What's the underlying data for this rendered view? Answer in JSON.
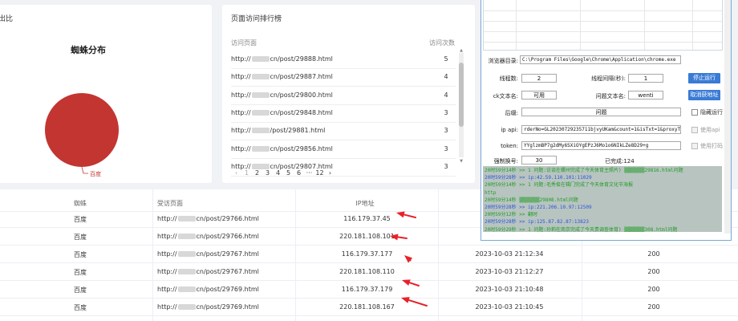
{
  "spider_card": {
    "title_fragment": "出比",
    "chart_title": "蜘蛛分布",
    "legend_label": "百度",
    "chart_data": {
      "type": "pie",
      "categories": [
        "百度"
      ],
      "values": [
        100
      ],
      "title": "蜘蛛分布",
      "colors": [
        "#c23531"
      ]
    }
  },
  "rank_card": {
    "title": "页面访问排行榜",
    "col_page": "访问页面",
    "col_count": "访问次数",
    "rows": [
      {
        "prefix": "http://",
        "suffix": "cn/post/29888.html",
        "count": "5"
      },
      {
        "prefix": "http://",
        "suffix": "cn/post/29887.html",
        "count": "4"
      },
      {
        "prefix": "http://",
        "suffix": "cn/post/29800.html",
        "count": "4"
      },
      {
        "prefix": "http://",
        "suffix": "cn/post/29848.html",
        "count": "3"
      },
      {
        "prefix": "http://",
        "suffix": "/post/29881.html",
        "count": "3"
      },
      {
        "prefix": "http://",
        "suffix": "cn/post/29856.html",
        "count": "3"
      },
      {
        "prefix": "http://",
        "suffix": "cn/post/29807.html",
        "count": "3"
      }
    ],
    "pager": {
      "prev": "‹",
      "pages": [
        "1",
        "2",
        "3",
        "4",
        "5",
        "6",
        "···",
        "12"
      ],
      "next": "›"
    }
  },
  "table": {
    "headers": {
      "spider": "蜘蛛",
      "page": "受访页面",
      "ip": "IP地址"
    },
    "rows": [
      {
        "spider": "百度",
        "prefix": "http://",
        "suffix": "cn/post/29766.html",
        "ip": "116.179.37.45",
        "time": "",
        "status": ""
      },
      {
        "spider": "百度",
        "prefix": "http://",
        "suffix": "cn/post/29766.html",
        "ip": "220.181.108.101",
        "time": "",
        "status": ""
      },
      {
        "spider": "百度",
        "prefix": "http://",
        "suffix": "cn/post/29767.html",
        "ip": "116.179.37.177",
        "time": "2023-10-03 21:12:34",
        "status": "200"
      },
      {
        "spider": "百度",
        "prefix": "http://",
        "suffix": "cn/post/29767.html",
        "ip": "220.181.108.110",
        "time": "2023-10-03 21:12:27",
        "status": "200"
      },
      {
        "spider": "百度",
        "prefix": "http://",
        "suffix": "cn/post/29769.html",
        "ip": "116.179.37.179",
        "time": "2023-10-03 21:10:48",
        "status": "200"
      },
      {
        "spider": "百度",
        "prefix": "http://",
        "suffix": "cn/post/29769.html",
        "ip": "220.181.108.167",
        "time": "2023-10-03 21:10:45",
        "status": "200"
      }
    ],
    "arrow_color": "#e8212a"
  },
  "tool": {
    "browser_dir_label": "浏览器目录:",
    "browser_dir_value": "C:\\Program Files\\Google\\Chrome\\Application\\chrome.exe",
    "threads_label": "线程数:",
    "threads_value": "2",
    "interval_label": "线程间隔(秒):",
    "interval_value": "1",
    "stop_button": "停止运行",
    "ck_label": "ck文本名:",
    "ck_value": "可用",
    "question_label": "问题文本名:",
    "question_value": "wenti",
    "cancel_proxy_button": "取消获地址",
    "suffix_label": "后缀:",
    "suffix_value": "问题",
    "hidden_run_label": "隐藏运行",
    "ip_api_label": "ip api:",
    "ip_api_value": "rderNo=GL20230729235711bjvyUKam&count=1&isTxt=1&proxyType=1",
    "use_api_label": "使用api",
    "token_label": "token:",
    "token_value": "YYglzmBP7g2dMy6SXiOYgEPzJ6Mo1o6NIkLZe8D29+g",
    "use_captcha_label": "使用打码",
    "switch_label": "强制换号:",
    "switch_value": "30",
    "done_label": "已完成:124",
    "log": [
      {
        "text": "20时59分14秒 >> 1 问题:访谈在螺州完成了今天体育主照片)",
        "tail": "29816.html问题",
        "color": "green"
      },
      {
        "text": "20时59分28秒 >> ip:42.59.110.101:11029",
        "tail": "",
        "color": "blue"
      },
      {
        "text": "20时59分14秒 >> 1 问题:毛秀俊在辑门完成了今天体育文化节海报",
        "tail": "",
        "color": "green"
      },
      {
        "text": "http",
        "tail": "",
        "color": "green"
      },
      {
        "text": "20时59分14秒",
        "tail": "29808.html问题",
        "color": "green"
      },
      {
        "text": "20时59分28秒 >> ip:221.206.10.97:12509",
        "tail": "",
        "color": "blue"
      },
      {
        "text": "20时59分12秒 >> 翻时",
        "tail": "",
        "color": "green"
      },
      {
        "text": "20时59分28秒 >> ip:125.87.82.87:13823",
        "tail": "",
        "color": "blue"
      },
      {
        "text": "20时59分29秒 >> 1 问题:孙莉在南京完成了今天贵调查体育)",
        "tail": "308.html问题",
        "color": "green"
      }
    ]
  }
}
